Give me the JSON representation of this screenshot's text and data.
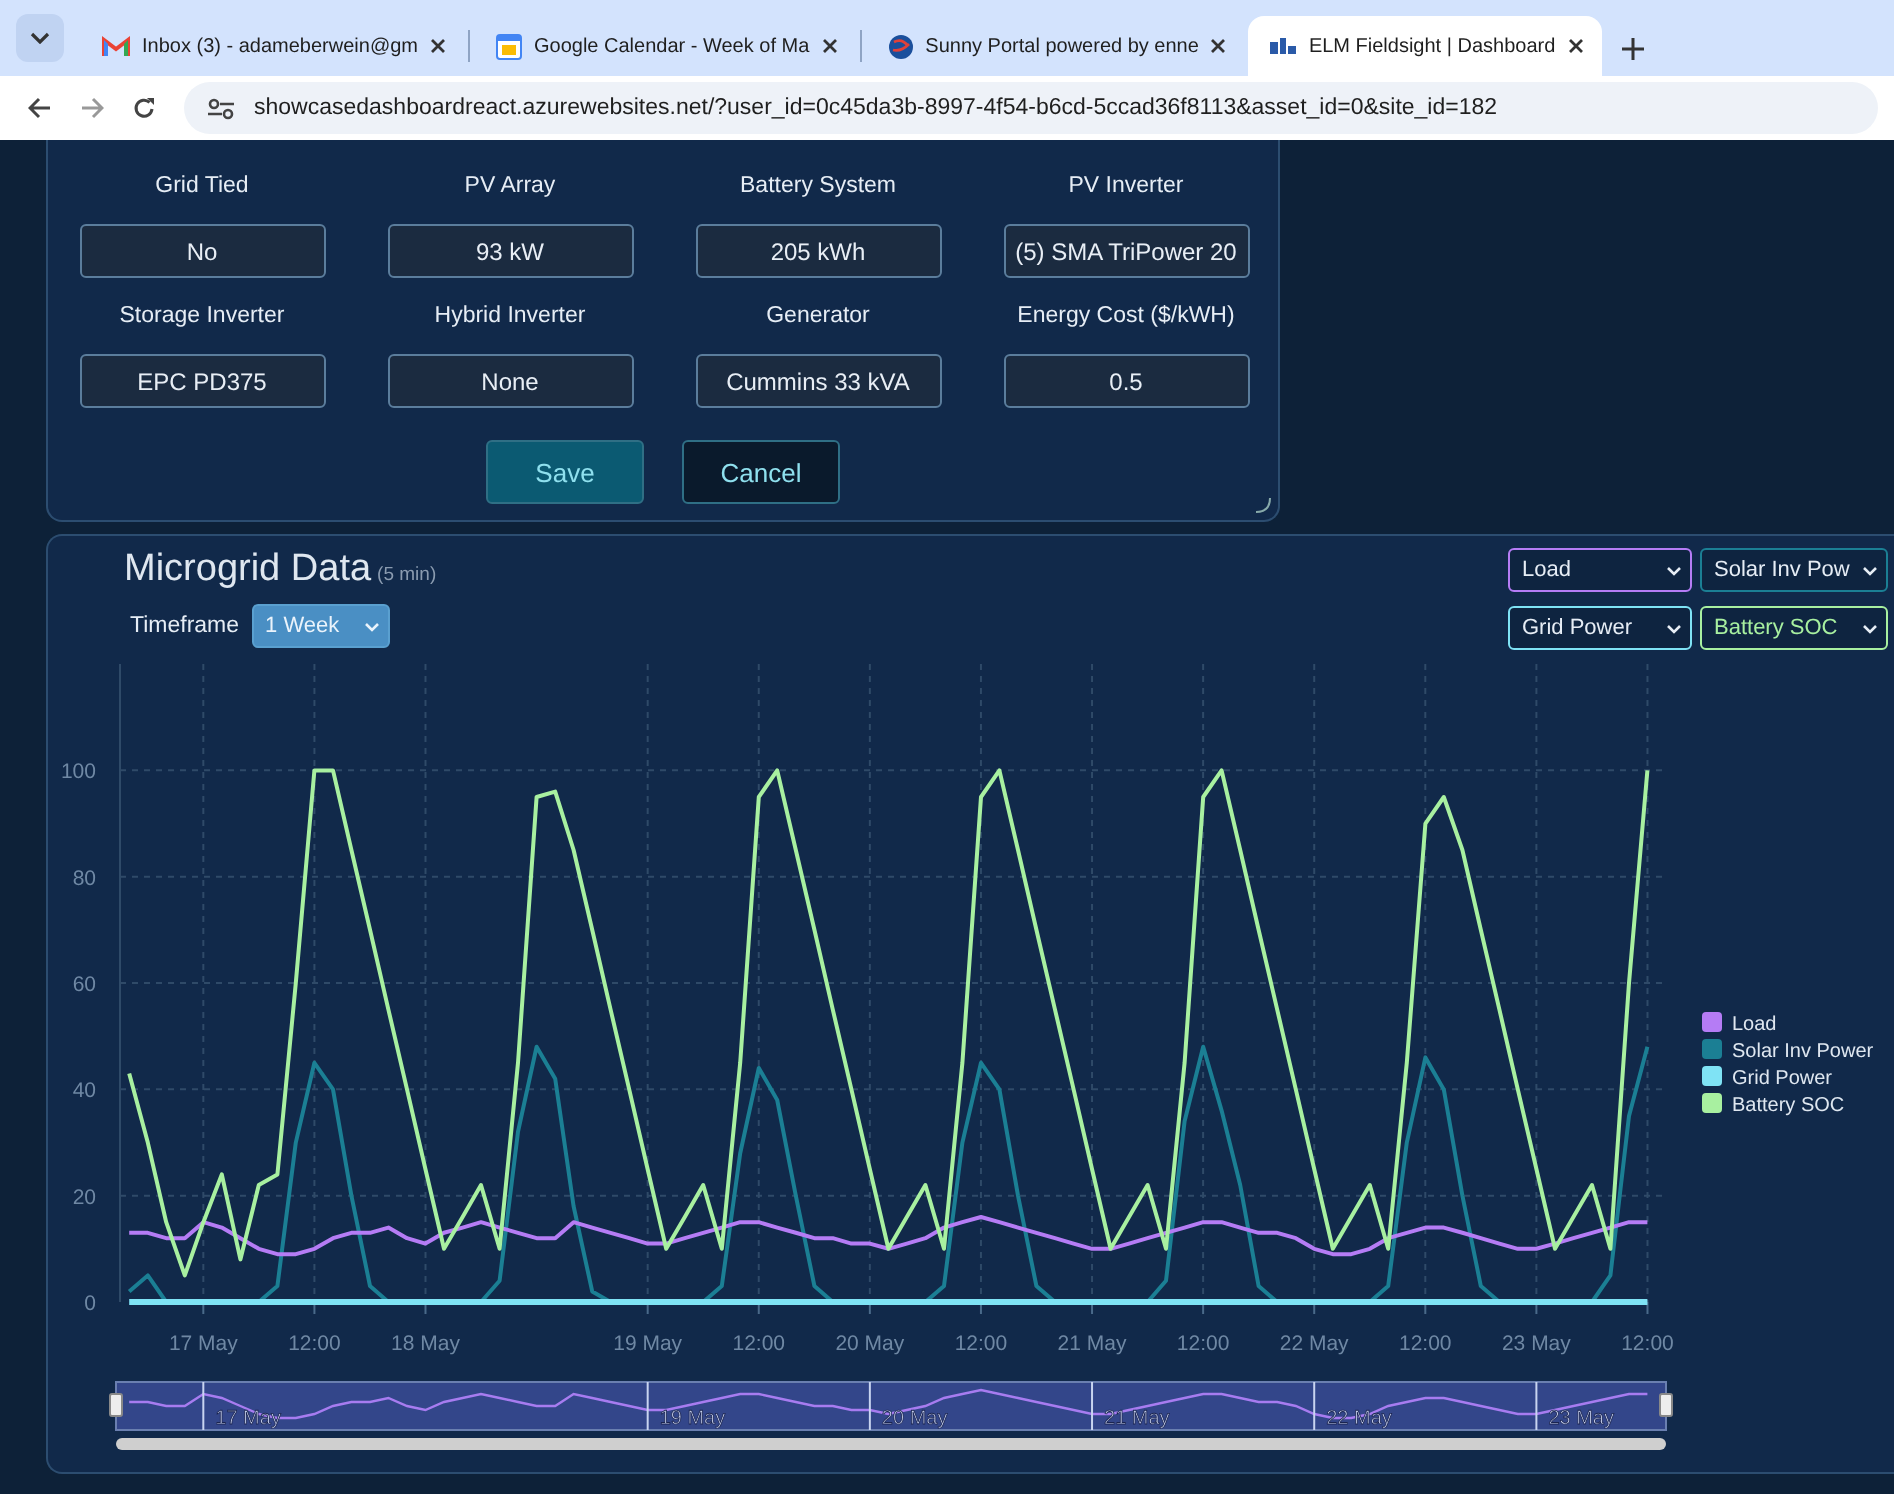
{
  "browser": {
    "tabs": [
      {
        "title": "Inbox (3) - adameberwein@gm",
        "selected": false
      },
      {
        "title": "Google Calendar - Week of Ma",
        "selected": false
      },
      {
        "title": "Sunny Portal powered by enne",
        "selected": false
      },
      {
        "title": "ELM Fieldsight | Dashboard",
        "selected": true
      }
    ],
    "url": "showcasedashboardreact.azurewebsites.net/?user_id=0c45da3b-8997-4f54-b6cd-5ccad36f8113&asset_id=0&site_id=182"
  },
  "system_form": {
    "fields": [
      {
        "label": "Grid Tied",
        "value": "No"
      },
      {
        "label": "PV Array",
        "value": "93 kW"
      },
      {
        "label": "Battery System",
        "value": "205 kWh"
      },
      {
        "label": "PV Inverter",
        "value": "(5) SMA TriPower 20"
      },
      {
        "label": "Storage Inverter",
        "value": "EPC PD375"
      },
      {
        "label": "Hybrid Inverter",
        "value": "None"
      },
      {
        "label": "Generator",
        "value": "Cummins 33 kVA"
      },
      {
        "label": "Energy Cost ($/kWH)",
        "value": "0.5"
      }
    ],
    "buttons": [
      {
        "label": "Save",
        "kind": "primary"
      },
      {
        "label": "Cancel",
        "kind": "secondary"
      }
    ]
  },
  "microgrid": {
    "title": "Microgrid Data",
    "subtitle": "(5 min)",
    "timeframe_label": "Timeframe",
    "timeframe": "1 Week",
    "series_selects": [
      "Load",
      "Solar Inv Pow",
      "Grid Power",
      "Battery SOC"
    ],
    "chart_data": {
      "type": "line",
      "grid": true,
      "legend": true,
      "ylim": [
        0,
        120
      ],
      "yticks": [
        0,
        20,
        40,
        60,
        80,
        100
      ],
      "categories": [
        null,
        null,
        null,
        null,
        "17 May",
        null,
        null,
        null,
        null,
        null,
        "12:00",
        null,
        null,
        null,
        null,
        null,
        "18 May",
        null,
        null,
        null,
        null,
        null,
        null,
        null,
        null,
        null,
        null,
        null,
        "19 May",
        null,
        null,
        null,
        null,
        null,
        "12:00",
        null,
        null,
        null,
        null,
        null,
        "20 May",
        null,
        null,
        null,
        null,
        null,
        "12:00",
        null,
        null,
        null,
        null,
        null,
        "21 May",
        null,
        null,
        null,
        null,
        null,
        "12:00",
        null,
        null,
        null,
        null,
        null,
        "22 May",
        null,
        null,
        null,
        null,
        null,
        "12:00",
        null,
        null,
        null,
        null,
        null,
        "23 May",
        null,
        null,
        null,
        null,
        null,
        "12:00"
      ],
      "series": [
        {
          "name": "Load",
          "color": "#b57cf5",
          "values": [
            13,
            13,
            12,
            12,
            15,
            14,
            12,
            10,
            9,
            9,
            10,
            12,
            13,
            13,
            14,
            12,
            11,
            13,
            14,
            15,
            14,
            13,
            12,
            12,
            15,
            14,
            13,
            12,
            11,
            11,
            12,
            13,
            14,
            15,
            15,
            14,
            13,
            12,
            12,
            11,
            11,
            10,
            11,
            12,
            14,
            15,
            16,
            15,
            14,
            13,
            12,
            11,
            10,
            10,
            11,
            12,
            13,
            14,
            15,
            15,
            14,
            13,
            13,
            12,
            10,
            9,
            9,
            10,
            12,
            13,
            14,
            14,
            13,
            12,
            11,
            10,
            10,
            11,
            12,
            13,
            14,
            15,
            15
          ]
        },
        {
          "name": "Solar Inv Power",
          "color": "#1b7f94",
          "values": [
            2,
            5,
            0,
            0,
            0,
            0,
            0,
            0,
            3,
            30,
            45,
            40,
            20,
            3,
            0,
            0,
            0,
            0,
            0,
            0,
            4,
            32,
            48,
            42,
            18,
            2,
            0,
            0,
            0,
            0,
            0,
            0,
            3,
            28,
            44,
            38,
            20,
            3,
            0,
            0,
            0,
            0,
            0,
            0,
            3,
            30,
            45,
            40,
            20,
            3,
            0,
            0,
            0,
            0,
            0,
            0,
            4,
            34,
            48,
            36,
            22,
            3,
            0,
            0,
            0,
            0,
            0,
            0,
            3,
            30,
            46,
            40,
            20,
            3,
            0,
            0,
            0,
            0,
            0,
            0,
            5,
            35,
            48
          ]
        },
        {
          "name": "Grid Power",
          "color": "#7fe3f5",
          "values": [
            0,
            0,
            0,
            0,
            0,
            0,
            0,
            0,
            0,
            0,
            0,
            0,
            0,
            0,
            0,
            0,
            0,
            0,
            0,
            0,
            0,
            0,
            0,
            0,
            0,
            0,
            0,
            0,
            0,
            0,
            0,
            0,
            0,
            0,
            0,
            0,
            0,
            0,
            0,
            0,
            0,
            0,
            0,
            0,
            0,
            0,
            0,
            0,
            0,
            0,
            0,
            0,
            0,
            0,
            0,
            0,
            0,
            0,
            0,
            0,
            0,
            0,
            0,
            0,
            0,
            0,
            0,
            0,
            0,
            0,
            0,
            0,
            0,
            0,
            0,
            0,
            0,
            0,
            0,
            0,
            0,
            0,
            0
          ]
        },
        {
          "name": "Battery SOC",
          "color": "#a8f0a0",
          "values": [
            43,
            30,
            15,
            5,
            15,
            24,
            8,
            22,
            24,
            60,
            100,
            100,
            85,
            70,
            55,
            40,
            25,
            10,
            16,
            22,
            10,
            45,
            95,
            96,
            85,
            70,
            55,
            40,
            25,
            10,
            16,
            22,
            10,
            45,
            95,
            100,
            85,
            70,
            55,
            40,
            25,
            10,
            16,
            22,
            10,
            45,
            95,
            100,
            85,
            70,
            55,
            40,
            25,
            10,
            16,
            22,
            10,
            45,
            95,
            100,
            85,
            70,
            55,
            40,
            25,
            10,
            16,
            22,
            10,
            45,
            90,
            95,
            85,
            70,
            55,
            40,
            25,
            10,
            16,
            22,
            10,
            60,
            100
          ]
        }
      ]
    },
    "navigator_labels": [
      "17 May",
      "19 May",
      "20 May",
      "21 May",
      "22 May",
      "23 May"
    ]
  }
}
